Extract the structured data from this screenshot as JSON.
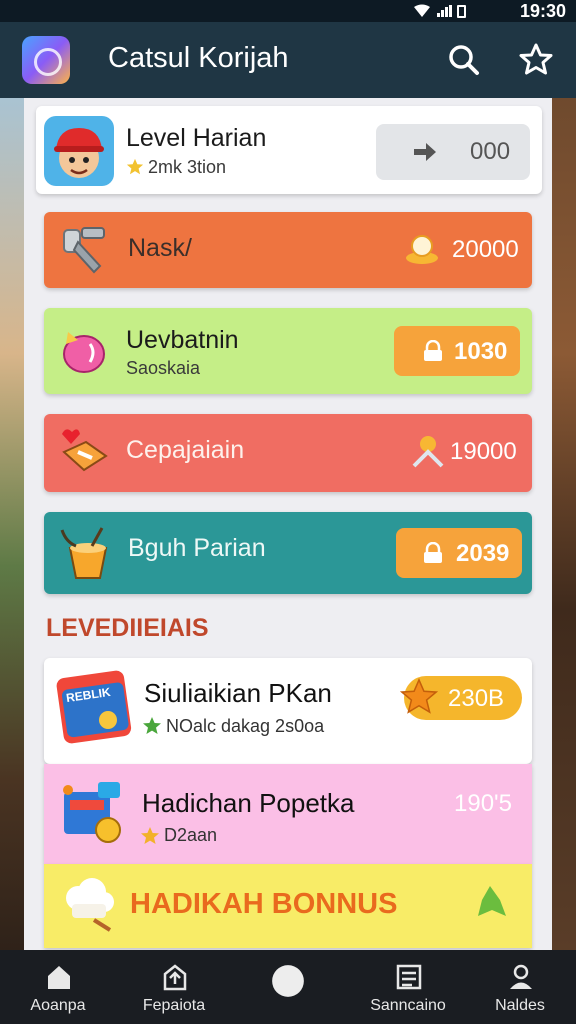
{
  "status": {
    "time": "19:30"
  },
  "header": {
    "title": "Catsul Korijah"
  },
  "cards": [
    {
      "title": "Level Harian",
      "subtitle": "2mk 3tion",
      "value": "000"
    },
    {
      "title": "Nask/",
      "value": "20000"
    },
    {
      "title": "Uevbatnin",
      "subtitle": "Saoskaia",
      "value": "1030"
    },
    {
      "title": "Cepajaiain",
      "value": "19000"
    },
    {
      "title": "Bguh Parian",
      "value": "2039"
    }
  ],
  "section": {
    "title": "LEVEDIIEIAIS"
  },
  "levels": [
    {
      "title": "Siuliaikian PKan",
      "subtitle": "NOalc dakag 2s0oa",
      "badge": "REBLIK",
      "value": "230B"
    },
    {
      "title": "Hadichan Popetka",
      "subtitle": "D2aan",
      "value": "190'5"
    },
    {
      "title": "HADIKAH BONNUS"
    }
  ],
  "nav": [
    {
      "label": "Aoanpa",
      "icon": "home-icon"
    },
    {
      "label": "Fepaiota",
      "icon": "upload-icon"
    },
    {
      "label": "",
      "icon": "circle-icon"
    },
    {
      "label": "Sanncaino",
      "icon": "list-icon"
    },
    {
      "label": "Naldes",
      "icon": "user-icon"
    }
  ],
  "colors": {
    "header_bg": "#1f3644",
    "orange_card": "#ee7440",
    "green_card": "#c5ee87",
    "red_card": "#f06d62",
    "teal_card": "#2b9797",
    "pink_card": "#fbbfe6",
    "yellow_card": "#f8ec67",
    "pill_orange": "#f6a33b"
  }
}
